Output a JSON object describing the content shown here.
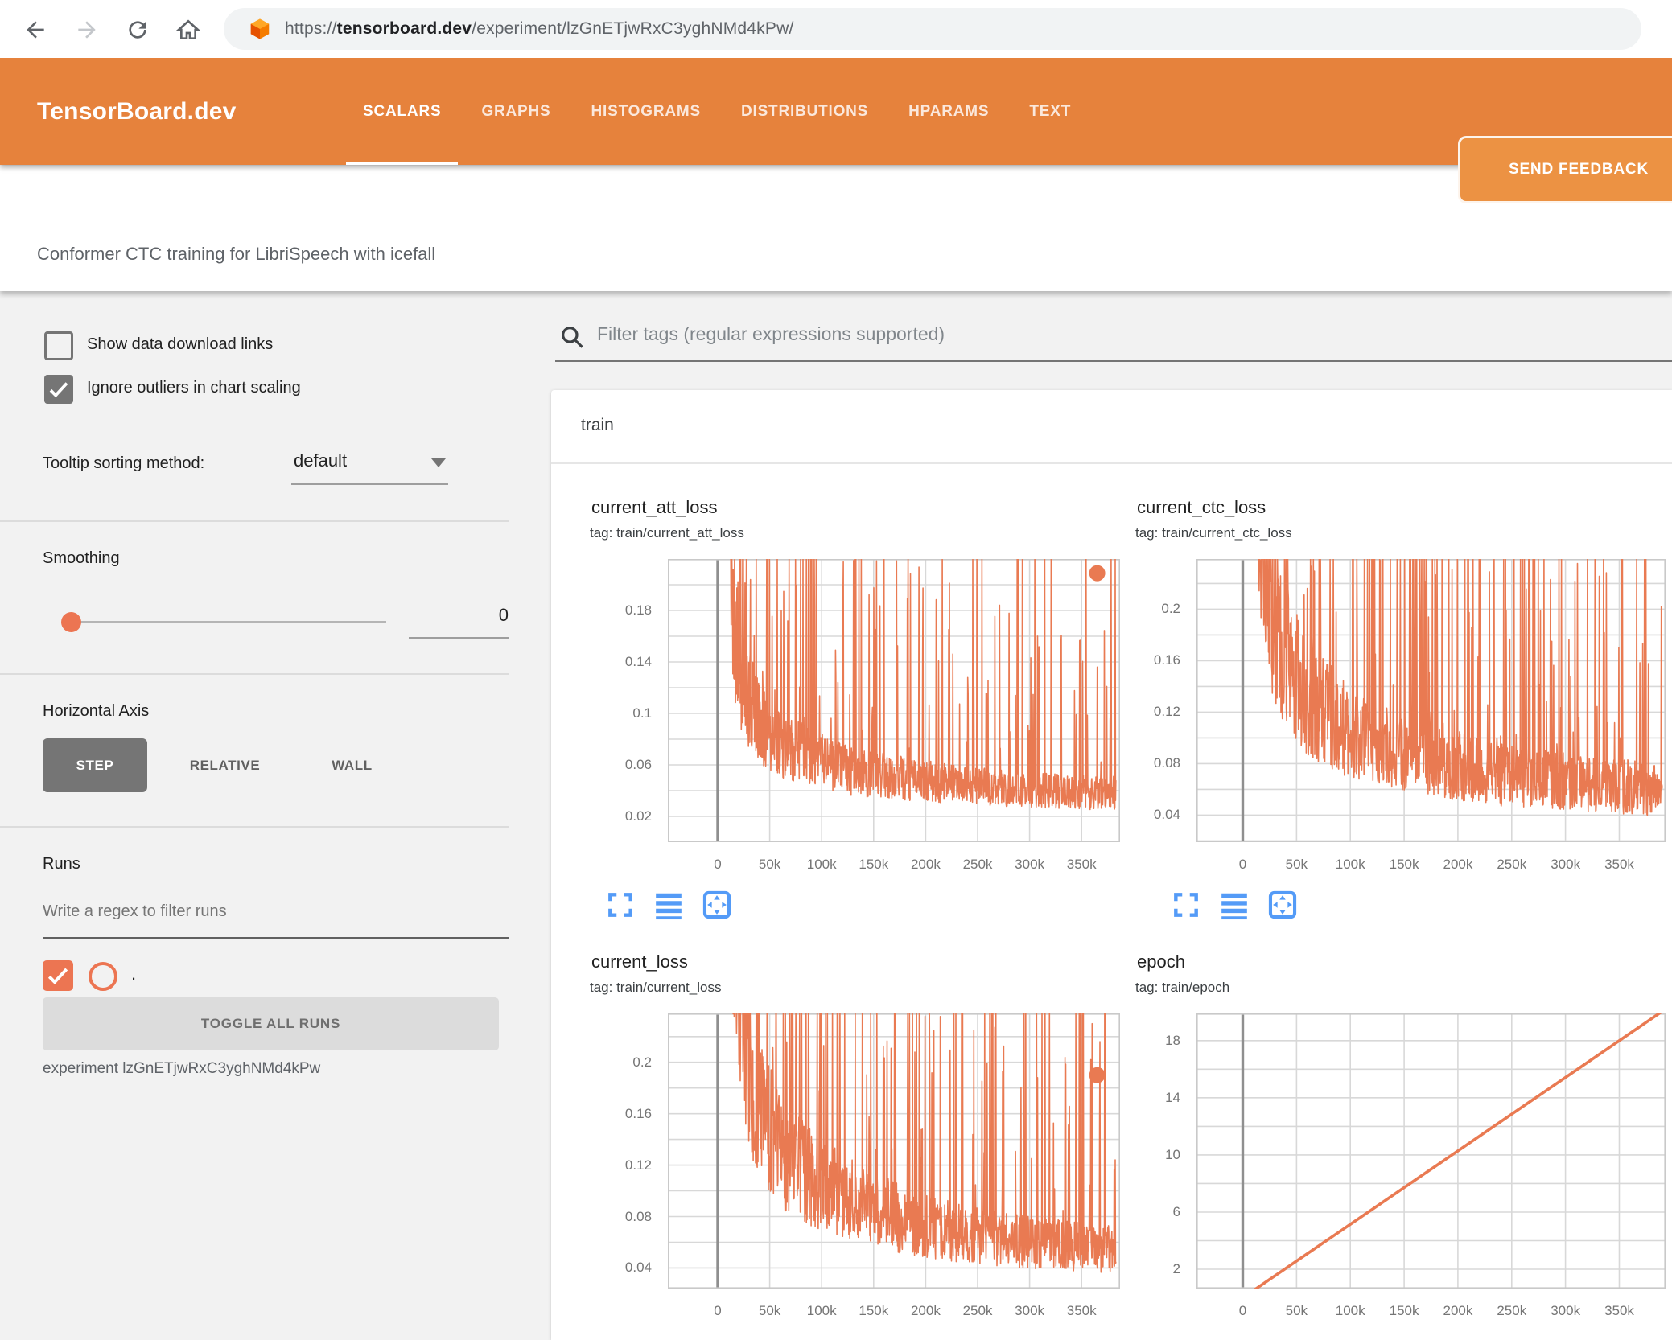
{
  "browser": {
    "url_scheme": "https://",
    "url_domain": "tensorboard.dev",
    "url_path": "/experiment/lzGnETjwRxC3yghNMd4kPw/"
  },
  "header": {
    "logo": "TensorBoard.dev",
    "nav": [
      {
        "label": "SCALARS",
        "active": true
      },
      {
        "label": "GRAPHS",
        "active": false
      },
      {
        "label": "HISTOGRAMS",
        "active": false
      },
      {
        "label": "DISTRIBUTIONS",
        "active": false
      },
      {
        "label": "HPARAMS",
        "active": false
      },
      {
        "label": "TEXT",
        "active": false
      }
    ],
    "feedback_label": "SEND FEEDBACK"
  },
  "subtitle": "Conformer CTC training for LibriSpeech with icefall",
  "sidebar": {
    "checkboxes": [
      {
        "label": "Show data download links",
        "checked": false
      },
      {
        "label": "Ignore outliers in chart scaling",
        "checked": true
      }
    ],
    "tooltip_sorting": {
      "label": "Tooltip sorting method:",
      "value": "default"
    },
    "smoothing": {
      "label": "Smoothing",
      "value": "0"
    },
    "horizontal_axis": {
      "label": "Horizontal Axis",
      "options": [
        "STEP",
        "RELATIVE",
        "WALL"
      ],
      "selected": "STEP"
    },
    "runs": {
      "label": "Runs",
      "filter_placeholder": "Write a regex to filter runs",
      "run_name": ".",
      "run_checked": true,
      "toggle_button": "TOGGLE ALL RUNS",
      "experiment": "experiment lzGnETjwRxC3yghNMd4kPw"
    }
  },
  "main": {
    "filter_placeholder": "Filter tags (regular expressions supported)",
    "section": "train"
  },
  "colors": {
    "header_bg": "#e6823c",
    "accent_orange": "#ec7552",
    "series_color": "#e97a52",
    "icon_blue": "#549bf7",
    "grid_light": "#d8d8d8",
    "axis_dark": "#8f8f8f"
  },
  "chart_data": [
    {
      "type": "line",
      "title": "current_att_loss",
      "tag": "tag: train/current_att_loss",
      "x_ticks": [
        "0",
        "50k",
        "100k",
        "150k",
        "200k",
        "250k",
        "300k",
        "350k"
      ],
      "x_tick_values": [
        0,
        50000,
        100000,
        150000,
        200000,
        250000,
        300000,
        350000
      ],
      "y_ticks": [
        0.02,
        0.06,
        0.1,
        0.14,
        0.18
      ],
      "y_grid_step": 0.02,
      "xlim": [
        -48000,
        387000
      ],
      "ylim": [
        0,
        0.22
      ],
      "trend_x": [
        8000,
        15000,
        25000,
        40000,
        60000,
        90000,
        130000,
        180000,
        240000,
        300000,
        365000
      ],
      "trend_y": [
        0.35,
        0.16,
        0.11,
        0.085,
        0.07,
        0.06,
        0.05,
        0.045,
        0.04,
        0.037,
        0.035
      ],
      "end_dot": {
        "x": 365000,
        "y": 0.209
      },
      "legend": "run .",
      "grid": true
    },
    {
      "type": "line",
      "title": "current_ctc_loss",
      "tag": "tag: train/current_ctc_loss",
      "x_ticks": [
        "0",
        "50k",
        "100k",
        "150k",
        "200k",
        "250k",
        "300k",
        "350k"
      ],
      "x_tick_values": [
        0,
        50000,
        100000,
        150000,
        200000,
        250000,
        300000,
        350000
      ],
      "y_ticks": [
        0.04,
        0.08,
        0.12,
        0.16,
        0.2
      ],
      "y_grid_step": 0.02,
      "xlim": [
        -43000,
        393000
      ],
      "ylim": [
        0.019,
        0.239
      ],
      "trend_x": [
        8000,
        15000,
        25000,
        40000,
        60000,
        90000,
        130000,
        180000,
        240000,
        300000,
        383000
      ],
      "trend_y": [
        0.5,
        0.28,
        0.19,
        0.15,
        0.12,
        0.1,
        0.085,
        0.075,
        0.065,
        0.06,
        0.055
      ],
      "end_dot": {
        "x": 383000,
        "y": 0.062
      },
      "legend": "run .",
      "grid": true
    },
    {
      "type": "line",
      "title": "current_loss",
      "tag": "tag: train/current_loss",
      "x_ticks": [
        "0",
        "50k",
        "100k",
        "150k",
        "200k",
        "250k",
        "300k",
        "350k"
      ],
      "x_tick_values": [
        0,
        50000,
        100000,
        150000,
        200000,
        250000,
        300000,
        350000
      ],
      "y_ticks": [
        0.04,
        0.08,
        0.12,
        0.16,
        0.2
      ],
      "y_grid_step": 0.02,
      "xlim": [
        -48000,
        387000
      ],
      "ylim": [
        0.024,
        0.238
      ],
      "trend_x": [
        8000,
        15000,
        25000,
        40000,
        60000,
        90000,
        130000,
        180000,
        240000,
        300000,
        365000
      ],
      "trend_y": [
        0.5,
        0.3,
        0.2,
        0.15,
        0.12,
        0.1,
        0.085,
        0.07,
        0.06,
        0.055,
        0.05
      ],
      "end_dot": {
        "x": 365000,
        "y": 0.19
      },
      "legend": "run .",
      "grid": true
    },
    {
      "type": "line",
      "title": "epoch",
      "tag": "tag: train/epoch",
      "x_ticks": [
        "0",
        "50k",
        "100k",
        "150k",
        "200k",
        "250k",
        "300k",
        "350k"
      ],
      "x_tick_values": [
        0,
        50000,
        100000,
        150000,
        200000,
        250000,
        300000,
        350000
      ],
      "y_ticks": [
        2,
        6,
        10,
        14,
        18
      ],
      "y_grid_step": 2,
      "xlim": [
        -43000,
        393000
      ],
      "ylim": [
        0.65,
        19.9
      ],
      "line": {
        "x": [
          0,
          390000
        ],
        "y": [
          0,
          20.05
        ]
      },
      "legend": "run .",
      "grid": true
    }
  ]
}
